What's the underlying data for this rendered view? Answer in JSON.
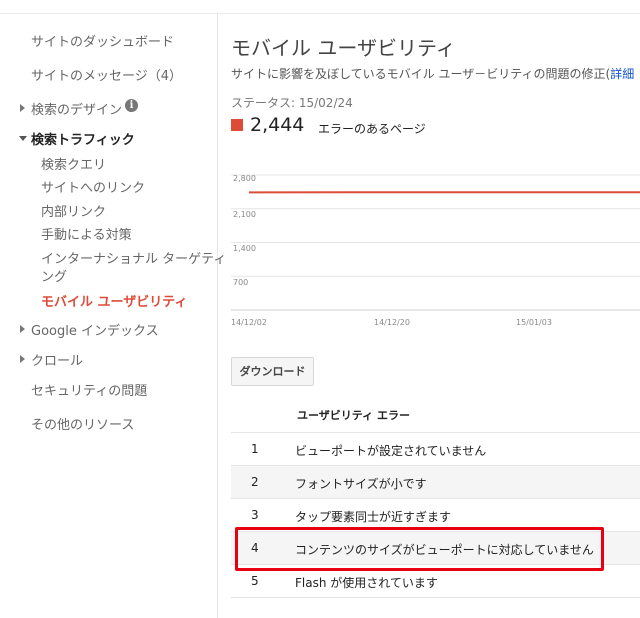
{
  "sidebar": {
    "items": [
      {
        "label": "サイトのダッシュボード"
      },
      {
        "label": "サイトのメッセージ（4）"
      },
      {
        "label": "検索のデザイン"
      },
      {
        "label": "検索トラフィック"
      },
      {
        "label": "検索クエリ"
      },
      {
        "label": "サイトへのリンク"
      },
      {
        "label": "内部リンク"
      },
      {
        "label": "手動による対策"
      },
      {
        "label": "インターナショナル ターゲティ"
      },
      {
        "label": "ング"
      },
      {
        "label": "モバイル ユーザビリティ"
      },
      {
        "label": "Google インデックス"
      },
      {
        "label": "クロール"
      },
      {
        "label": "セキュリティの問題"
      },
      {
        "label": "その他のリソース"
      }
    ],
    "info_glyph": "i"
  },
  "main": {
    "title": "モバイル ユーザビリティ",
    "description": "サイトに影響を及ぼしているモバイル ユーザ－ビリティの問題の修正(",
    "details_link": "詳細",
    "status": "ステータス: 15/02/24",
    "error_count": "2,444",
    "error_label": "エラーのあるページ",
    "download_label": "ダウンロード"
  },
  "colors": {
    "accent_red": "#dd4b39",
    "highlight_red": "#e60012",
    "link_blue": "#1155cc"
  },
  "chart_data": {
    "type": "line",
    "y_ticks": [
      "2,800",
      "2,100",
      "1,400",
      "700"
    ],
    "x_ticks": [
      "14/12/02",
      "14/12/20",
      "15/01/03"
    ],
    "ylim": [
      0,
      2800
    ],
    "series": [
      {
        "values": [
          2440,
          2442,
          2444,
          2444,
          2444
        ],
        "color": "#dd4b39"
      }
    ],
    "grid": true
  },
  "table": {
    "header": "ユーザビリティ エラー",
    "rows": [
      {
        "num": "1",
        "text": "ビューポートが設定されていません"
      },
      {
        "num": "2",
        "text": "フォントサイズが小です"
      },
      {
        "num": "3",
        "text": "タップ要素同士が近すぎます"
      },
      {
        "num": "4",
        "text": "コンテンツのサイズがビューポートに対応していません"
      },
      {
        "num": "5",
        "text": "Flash が使用されています"
      }
    ]
  }
}
